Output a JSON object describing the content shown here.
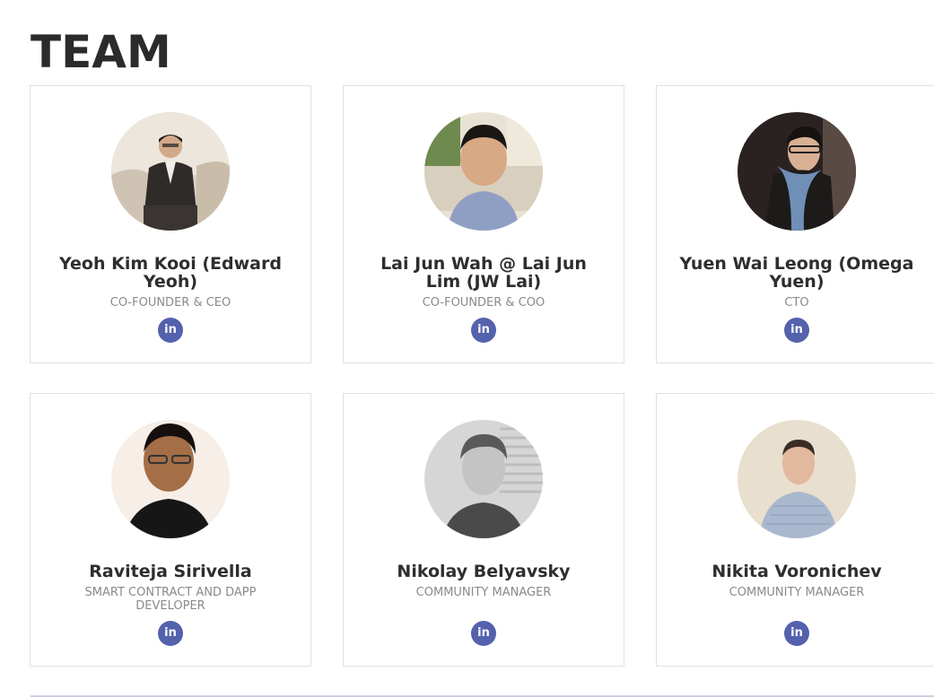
{
  "section": {
    "title": "TEAM"
  },
  "team": [
    {
      "name": "Yeoh Kim Kooi (Edward Yeoh)",
      "role": "CO-FOUNDER & CEO",
      "social_label": "in",
      "icon": "linkedin-icon"
    },
    {
      "name": "Lai Jun Wah @ Lai Jun Lim (JW Lai)",
      "role": "CO-FOUNDER & COO",
      "social_label": "in",
      "icon": "linkedin-icon"
    },
    {
      "name": "Yuen Wai Leong (Omega Yuen)",
      "role": "CTO",
      "social_label": "in",
      "icon": "linkedin-icon"
    },
    {
      "name": "Raviteja Sirivella",
      "role": "SMART CONTRACT AND DAPP DEVELOPER",
      "social_label": "in",
      "icon": "linkedin-icon"
    },
    {
      "name": "Nikolay Belyavsky",
      "role": "COMMUNITY MANAGER",
      "social_label": "in",
      "icon": "linkedin-icon"
    },
    {
      "name": "Nikita Voronichev",
      "role": "COMMUNITY MANAGER",
      "social_label": "in",
      "icon": "linkedin-icon"
    }
  ],
  "colors": {
    "title": "#2b2b2b",
    "name": "#2e2e2e",
    "role": "#8a8a8a",
    "linkedin_badge": "#5461ad",
    "card_border": "#e1e1e1"
  }
}
